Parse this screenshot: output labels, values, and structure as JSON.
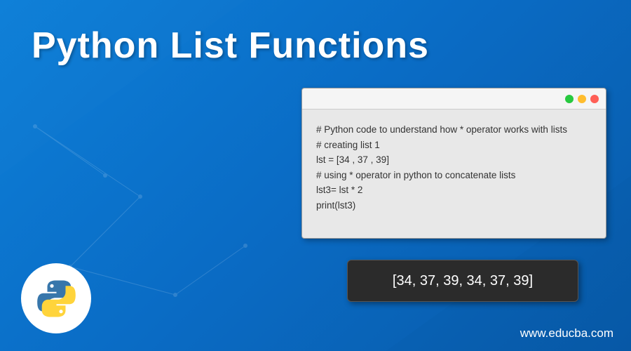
{
  "title": "Python List Functions",
  "code": {
    "line1": "# Python code to understand how * operator works with lists",
    "line2": "# creating list 1",
    "line3": "lst = [34 , 37 , 39]",
    "line4": "# using * operator in python to concatenate lists",
    "line5": "lst3= lst * 2",
    "line6": "print(lst3)"
  },
  "output": "[34, 37, 39, 34, 37, 39]",
  "website": "www.educba.com",
  "colors": {
    "bg_start": "#0d7fd8",
    "bg_end": "#085aa8",
    "window_bg": "#e8e8e8",
    "output_bg": "#2b2b2b"
  }
}
